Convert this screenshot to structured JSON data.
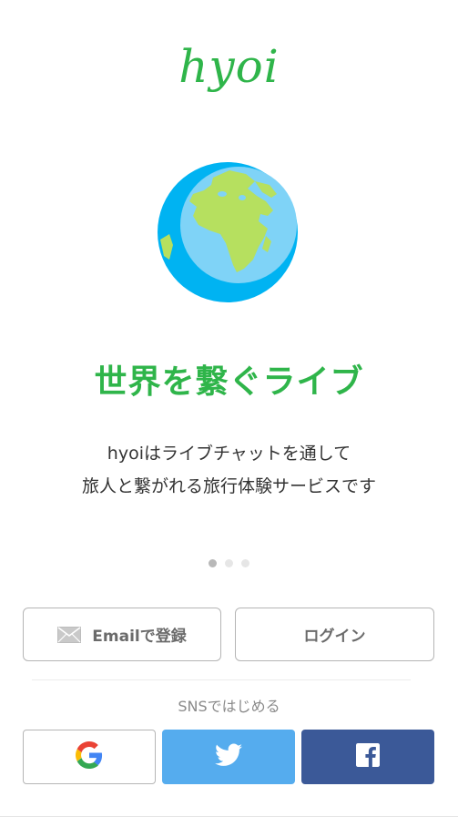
{
  "app": {
    "logo_text": "hyoi"
  },
  "hero": {
    "headline": "世界を繋ぐライブ",
    "subtitle_line1": "hyoiはライブチャットを通して",
    "subtitle_line2": "旅人と繋がれる旅行体験サービスです"
  },
  "carousel": {
    "total": 3,
    "active_index": 0
  },
  "actions": {
    "email_signup_label": "Emailで登録",
    "login_label": "ログイン"
  },
  "sns": {
    "label": "SNSではじめる",
    "providers": [
      {
        "name": "google",
        "icon": "google-icon"
      },
      {
        "name": "twitter",
        "icon": "twitter-icon",
        "color": "#55acee"
      },
      {
        "name": "facebook",
        "icon": "facebook-icon",
        "color": "#3b5998"
      }
    ]
  },
  "colors": {
    "brand": "#2fb54a",
    "twitter": "#55acee",
    "facebook": "#3b5998"
  }
}
